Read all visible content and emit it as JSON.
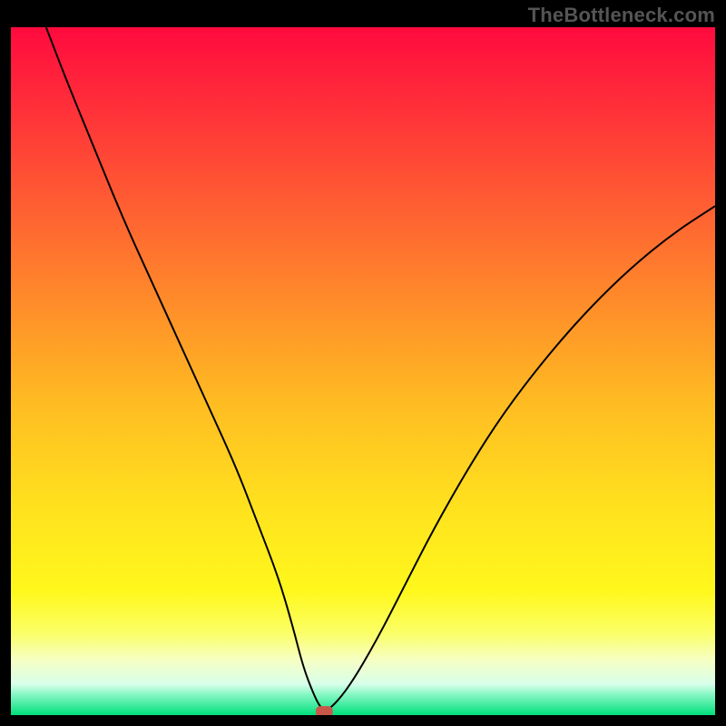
{
  "watermark": "TheBottleneck.com",
  "colors": {
    "bg": "#000000",
    "line": "#000000",
    "marker_fill": "#c9574a",
    "gradient": [
      {
        "stop": 0.0,
        "color": "#ff0a3e"
      },
      {
        "stop": 0.1,
        "color": "#ff2a3a"
      },
      {
        "stop": 0.25,
        "color": "#ff5b33"
      },
      {
        "stop": 0.4,
        "color": "#ff8c2a"
      },
      {
        "stop": 0.55,
        "color": "#ffbd22"
      },
      {
        "stop": 0.7,
        "color": "#ffe21e"
      },
      {
        "stop": 0.82,
        "color": "#fff81c"
      },
      {
        "stop": 0.88,
        "color": "#fbff66"
      },
      {
        "stop": 0.92,
        "color": "#f6ffc4"
      },
      {
        "stop": 0.955,
        "color": "#d8ffea"
      },
      {
        "stop": 0.97,
        "color": "#86f7c4"
      },
      {
        "stop": 1.0,
        "color": "#00e07a"
      }
    ]
  },
  "chart_data": {
    "type": "line",
    "title": "",
    "xlabel": "",
    "ylabel": "",
    "xlim": [
      0,
      100
    ],
    "ylim": [
      0,
      100
    ],
    "series": [
      {
        "name": "bottleneck-curve",
        "x": [
          5,
          8,
          12,
          16,
          20,
          24,
          28,
          32,
          35,
          38,
          40,
          41.5,
          43,
          44,
          45,
          48,
          52,
          56,
          60,
          65,
          70,
          76,
          82,
          88,
          94,
          100
        ],
        "y": [
          100,
          92,
          82,
          72,
          63,
          54,
          45,
          36,
          28,
          20,
          13,
          7,
          3,
          1,
          0.5,
          4,
          11,
          19,
          27,
          36,
          44,
          52,
          59,
          65,
          70,
          74
        ]
      }
    ],
    "marker": {
      "x": 44.5,
      "y": 0.5
    }
  }
}
